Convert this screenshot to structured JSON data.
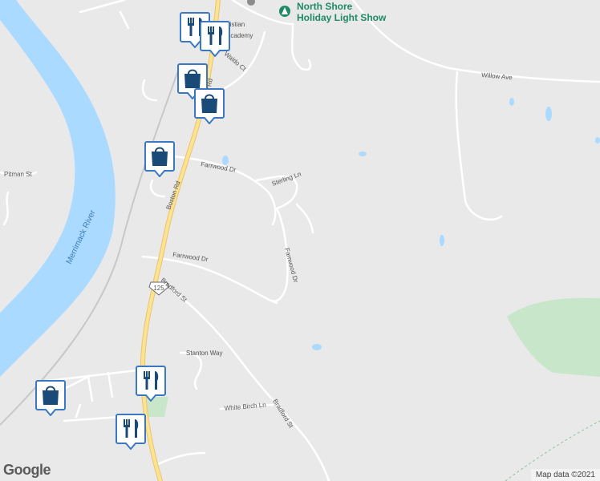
{
  "map": {
    "roads": {
      "boston_rd": "Boston Rd",
      "boston_rd_upper": "e Rd",
      "willow_ave": "Willow Ave",
      "waldo_ct": "Waldo Ct",
      "farrwood_dr_1": "Farrwood Dr",
      "farrwood_dr_2": "Farrwood Dr",
      "farrwood_dr_3": "Farrwood Dr",
      "sterling_ln": "Sterling Ln",
      "bradford_st_1": "Bradford St",
      "bradford_st_2": "Bradford St",
      "stanton_way": "Stanton Way",
      "white_birch_ln": "White Birch Ln",
      "pitman_st": "Pitman St",
      "route_125": "125"
    },
    "water": {
      "river": "Merrimack River"
    },
    "poi": {
      "north_shore_line1": "North Shore",
      "north_shore_line2": "Holiday Light Show",
      "academy_line1": "Bri   d Christian",
      "academy_line2": "Academy"
    },
    "markers": [
      {
        "type": "restaurant",
        "icon": "fork-knife-icon"
      },
      {
        "type": "restaurant",
        "icon": "fork-knife-icon"
      },
      {
        "type": "shopping",
        "icon": "shopping-bag-icon"
      },
      {
        "type": "shopping",
        "icon": "shopping-bag-icon"
      },
      {
        "type": "shopping",
        "icon": "shopping-bag-icon"
      },
      {
        "type": "restaurant",
        "icon": "fork-knife-icon"
      },
      {
        "type": "shopping",
        "icon": "shopping-bag-icon"
      },
      {
        "type": "restaurant",
        "icon": "fork-knife-icon"
      }
    ],
    "colors": {
      "water": "#aadaff",
      "park": "#c8e6c9",
      "road": "#ffffff",
      "highway": "#fde293",
      "marker_fill": "#1a4a78",
      "marker_border": "#3b78c2"
    }
  },
  "branding": {
    "logo": "Google",
    "attribution": "Map data ©2021"
  }
}
